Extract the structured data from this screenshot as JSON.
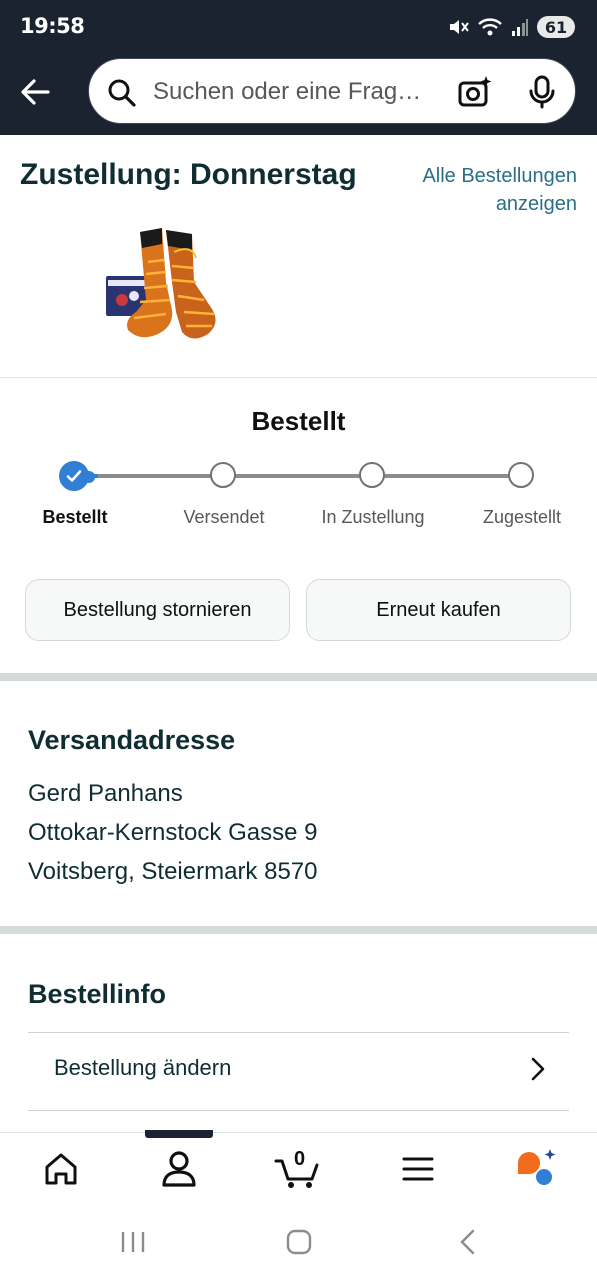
{
  "status_bar": {
    "time": "19:58",
    "battery": "61"
  },
  "search": {
    "placeholder": "Suchen oder eine Frag…"
  },
  "delivery": {
    "title": "Zustellung: Donnerstag",
    "all_orders_link": "Alle Bestellungen anzeigen"
  },
  "progress": {
    "heading": "Bestellt",
    "steps": [
      {
        "label": "Bestellt",
        "done": true
      },
      {
        "label": "Versendet",
        "done": false
      },
      {
        "label": "In Zustellung",
        "done": false
      },
      {
        "label": "Zugestellt",
        "done": false
      }
    ]
  },
  "actions": {
    "cancel_label": "Bestellung stornieren",
    "buy_again_label": "Erneut kaufen"
  },
  "shipping": {
    "title": "Versandadresse",
    "name": "Gerd Panhans",
    "street": "Ottokar-Kernstock Gasse 9",
    "city": "Voitsberg, Steiermark 8570"
  },
  "order_info": {
    "title": "Bestellinfo",
    "change_order": "Bestellung ändern"
  },
  "bottom_nav": {
    "cart_count": "0",
    "items": [
      "home-icon",
      "account-icon",
      "cart-icon",
      "menu-icon",
      "rufus-icon"
    ]
  },
  "colors": {
    "header_bg": "#1b2330",
    "accent_blue": "#2f7fd6",
    "link": "#2a6f8a",
    "rufus_orange": "#f26b1d"
  }
}
